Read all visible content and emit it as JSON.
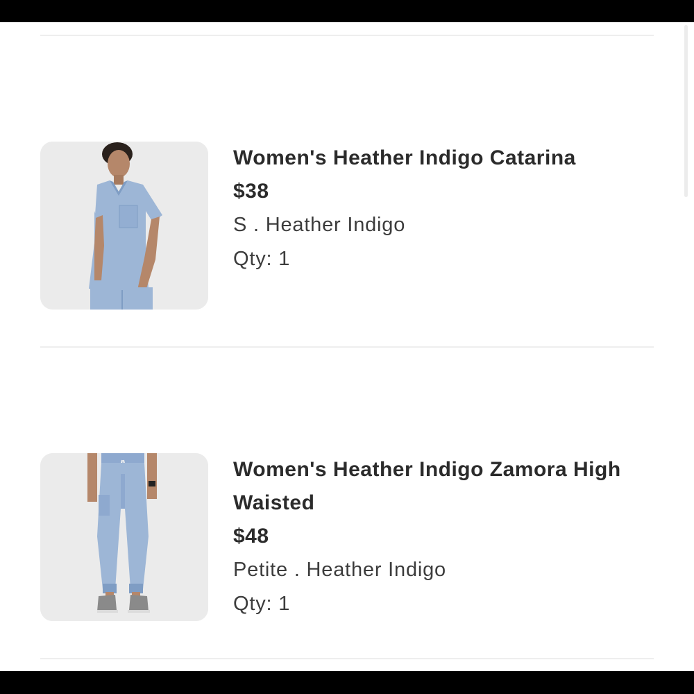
{
  "cart": {
    "items": [
      {
        "name": "Women's Heather Indigo Catarina",
        "price": "$38",
        "variant": "S . Heather Indigo",
        "qty_label": "Qty:",
        "qty_value": "1",
        "image_icon": "scrub-top-photo"
      },
      {
        "name": "Women's Heather Indigo Zamora High Waisted",
        "price": "$48",
        "variant": "Petite . Heather Indigo",
        "qty_label": "Qty:",
        "qty_value": "1",
        "image_icon": "scrub-pants-photo"
      }
    ]
  },
  "colors": {
    "scrub": "#9db6d6",
    "scrub_dark": "#7f9dc4",
    "photo_bg": "#ebebeb",
    "text": "#2b2b2b"
  }
}
